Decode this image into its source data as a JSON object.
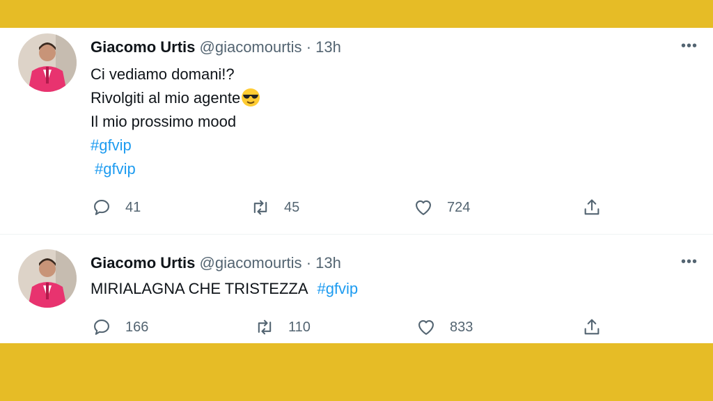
{
  "tweets": [
    {
      "name": "Giacomo Urtis",
      "handle": "@giacomourtis",
      "separator": "·",
      "time": "13h",
      "lines": [
        "Ci vediamo domani!?",
        "Rivolgiti al mio agente",
        "Il mio prossimo mood"
      ],
      "hashtags": [
        "#gfvip",
        "#gfvip"
      ],
      "more": "•••",
      "actions": {
        "reply": "41",
        "retweet": "45",
        "like": "724"
      }
    },
    {
      "name": "Giacomo Urtis",
      "handle": "@giacomourtis",
      "separator": "·",
      "time": "13h",
      "text": "MIRIALAGNA CHE TRISTEZZA",
      "hashtag": "#gfvip",
      "more": "•••",
      "actions": {
        "reply": "166",
        "retweet": "110",
        "like": "833"
      }
    }
  ],
  "colors": {
    "background": "#e6bc26",
    "link": "#1d9bf0",
    "muted": "#536471",
    "jacket": "#e8336f"
  },
  "icons": [
    "reply-icon",
    "retweet-icon",
    "like-icon",
    "share-icon",
    "more-icon",
    "sunglasses-emoji"
  ]
}
